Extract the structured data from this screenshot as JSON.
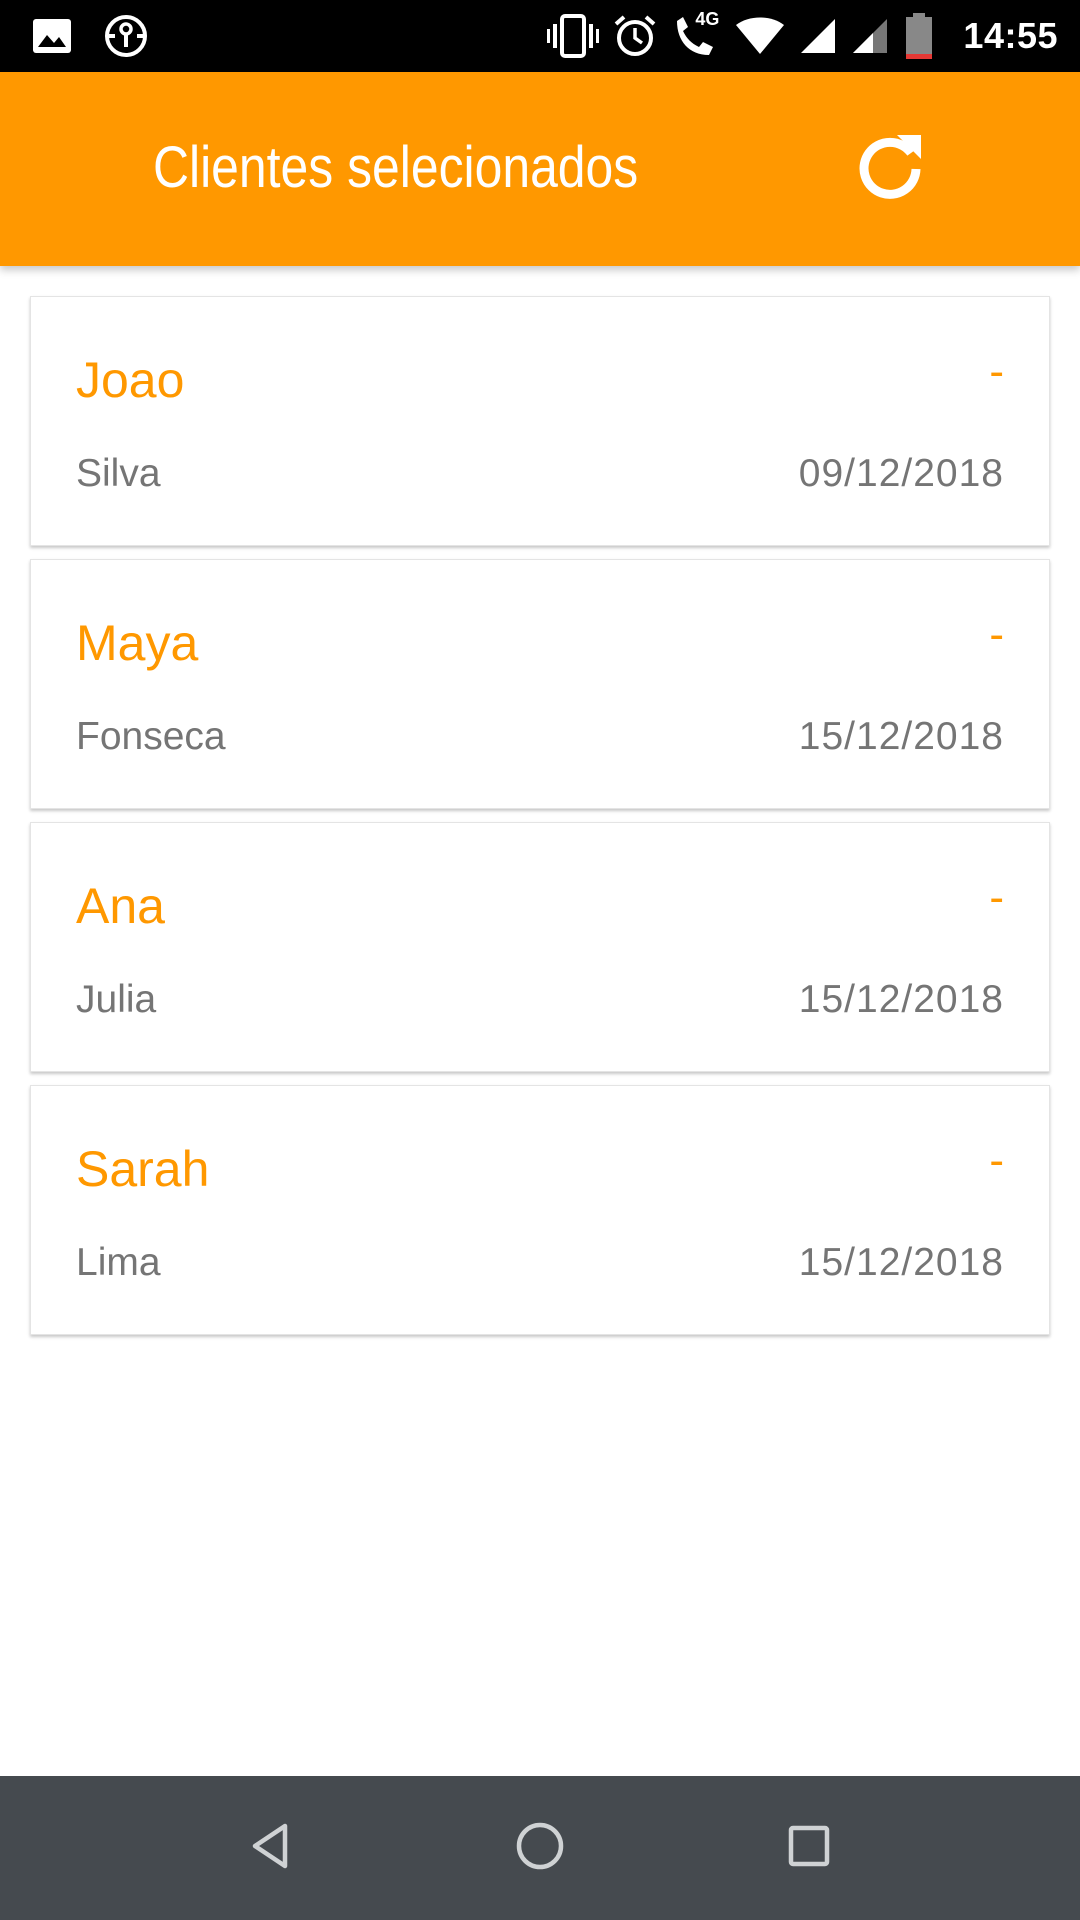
{
  "status_bar": {
    "time": "14:55",
    "network_label": "4G",
    "icons": [
      "gallery-icon",
      "vpn-key-icon",
      "vibrate-icon",
      "alarm-icon",
      "volte-call-icon",
      "wifi-icon",
      "signal-icon",
      "signal-2-icon",
      "battery-low-icon"
    ],
    "battery_color": "#e53935"
  },
  "app_bar": {
    "title": "Clientes selecionados",
    "background": "#FF9800",
    "refresh_icon": "refresh-icon"
  },
  "clients": [
    {
      "name": "Joao",
      "indicator": "-",
      "surname": "Silva",
      "date": "09/12/2018"
    },
    {
      "name": "Maya",
      "indicator": "-",
      "surname": "Fonseca",
      "date": "15/12/2018"
    },
    {
      "name": "Ana",
      "indicator": "-",
      "surname": "Julia",
      "date": "15/12/2018"
    },
    {
      "name": "Sarah",
      "indicator": "-",
      "surname": "Lima",
      "date": "15/12/2018"
    }
  ],
  "nav_bar": {
    "icons": [
      "back-icon",
      "home-icon",
      "recents-icon"
    ]
  },
  "colors": {
    "accent": "#FF9800",
    "secondary_text": "#757575",
    "nav_bar": "#454a4f"
  }
}
